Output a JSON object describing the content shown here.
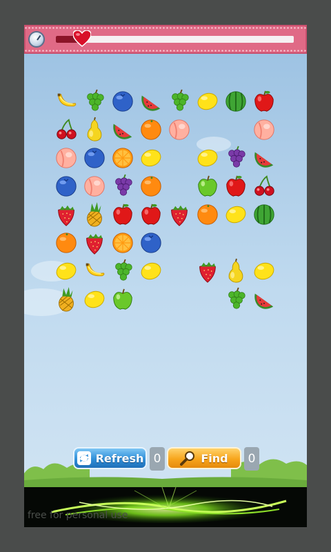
{
  "header": {
    "timer_icon": "stopwatch-icon",
    "time_remaining_fraction": 0.11,
    "heart_icon": "heart-icon",
    "colors": {
      "bar": "#e06a86",
      "fill": "#8b1428"
    }
  },
  "board": {
    "rows": [
      [
        "banana",
        "grapes",
        "blueberry",
        "watermelon",
        "grapes",
        "lemon",
        "melon",
        "apple"
      ],
      [
        "cherry",
        "pear",
        "watermelon",
        "orange",
        "peach",
        null,
        null,
        "peach"
      ],
      [
        "peach",
        "blueberry",
        "orange-slice",
        "lemon",
        null,
        "lemon",
        "purple-grapes",
        "watermelon"
      ],
      [
        "blueberry",
        "peach",
        "purple-grapes",
        "orange",
        null,
        "green-apple",
        "apple",
        "cherry"
      ],
      [
        "strawberry",
        "pineapple",
        "apple",
        "apple",
        "strawberry",
        "orange",
        "lemon",
        "melon"
      ],
      [
        "orange",
        "strawberry",
        "orange-slice",
        "blueberry",
        null,
        null,
        null,
        null
      ],
      [
        "lemon",
        "banana",
        "grapes",
        "lemon",
        null,
        "strawberry",
        "pear",
        "lemon"
      ],
      [
        "pineapple",
        "lemon",
        "green-apple",
        null,
        null,
        null,
        "grapes",
        "watermelon"
      ]
    ]
  },
  "controls": {
    "refresh_label": "Refresh",
    "refresh_icon": "refresh-icon",
    "refresh_count": "0",
    "find_label": "Find",
    "find_icon": "magnifier-icon",
    "find_count": "0"
  },
  "ad": {
    "text": "free for personal use"
  }
}
